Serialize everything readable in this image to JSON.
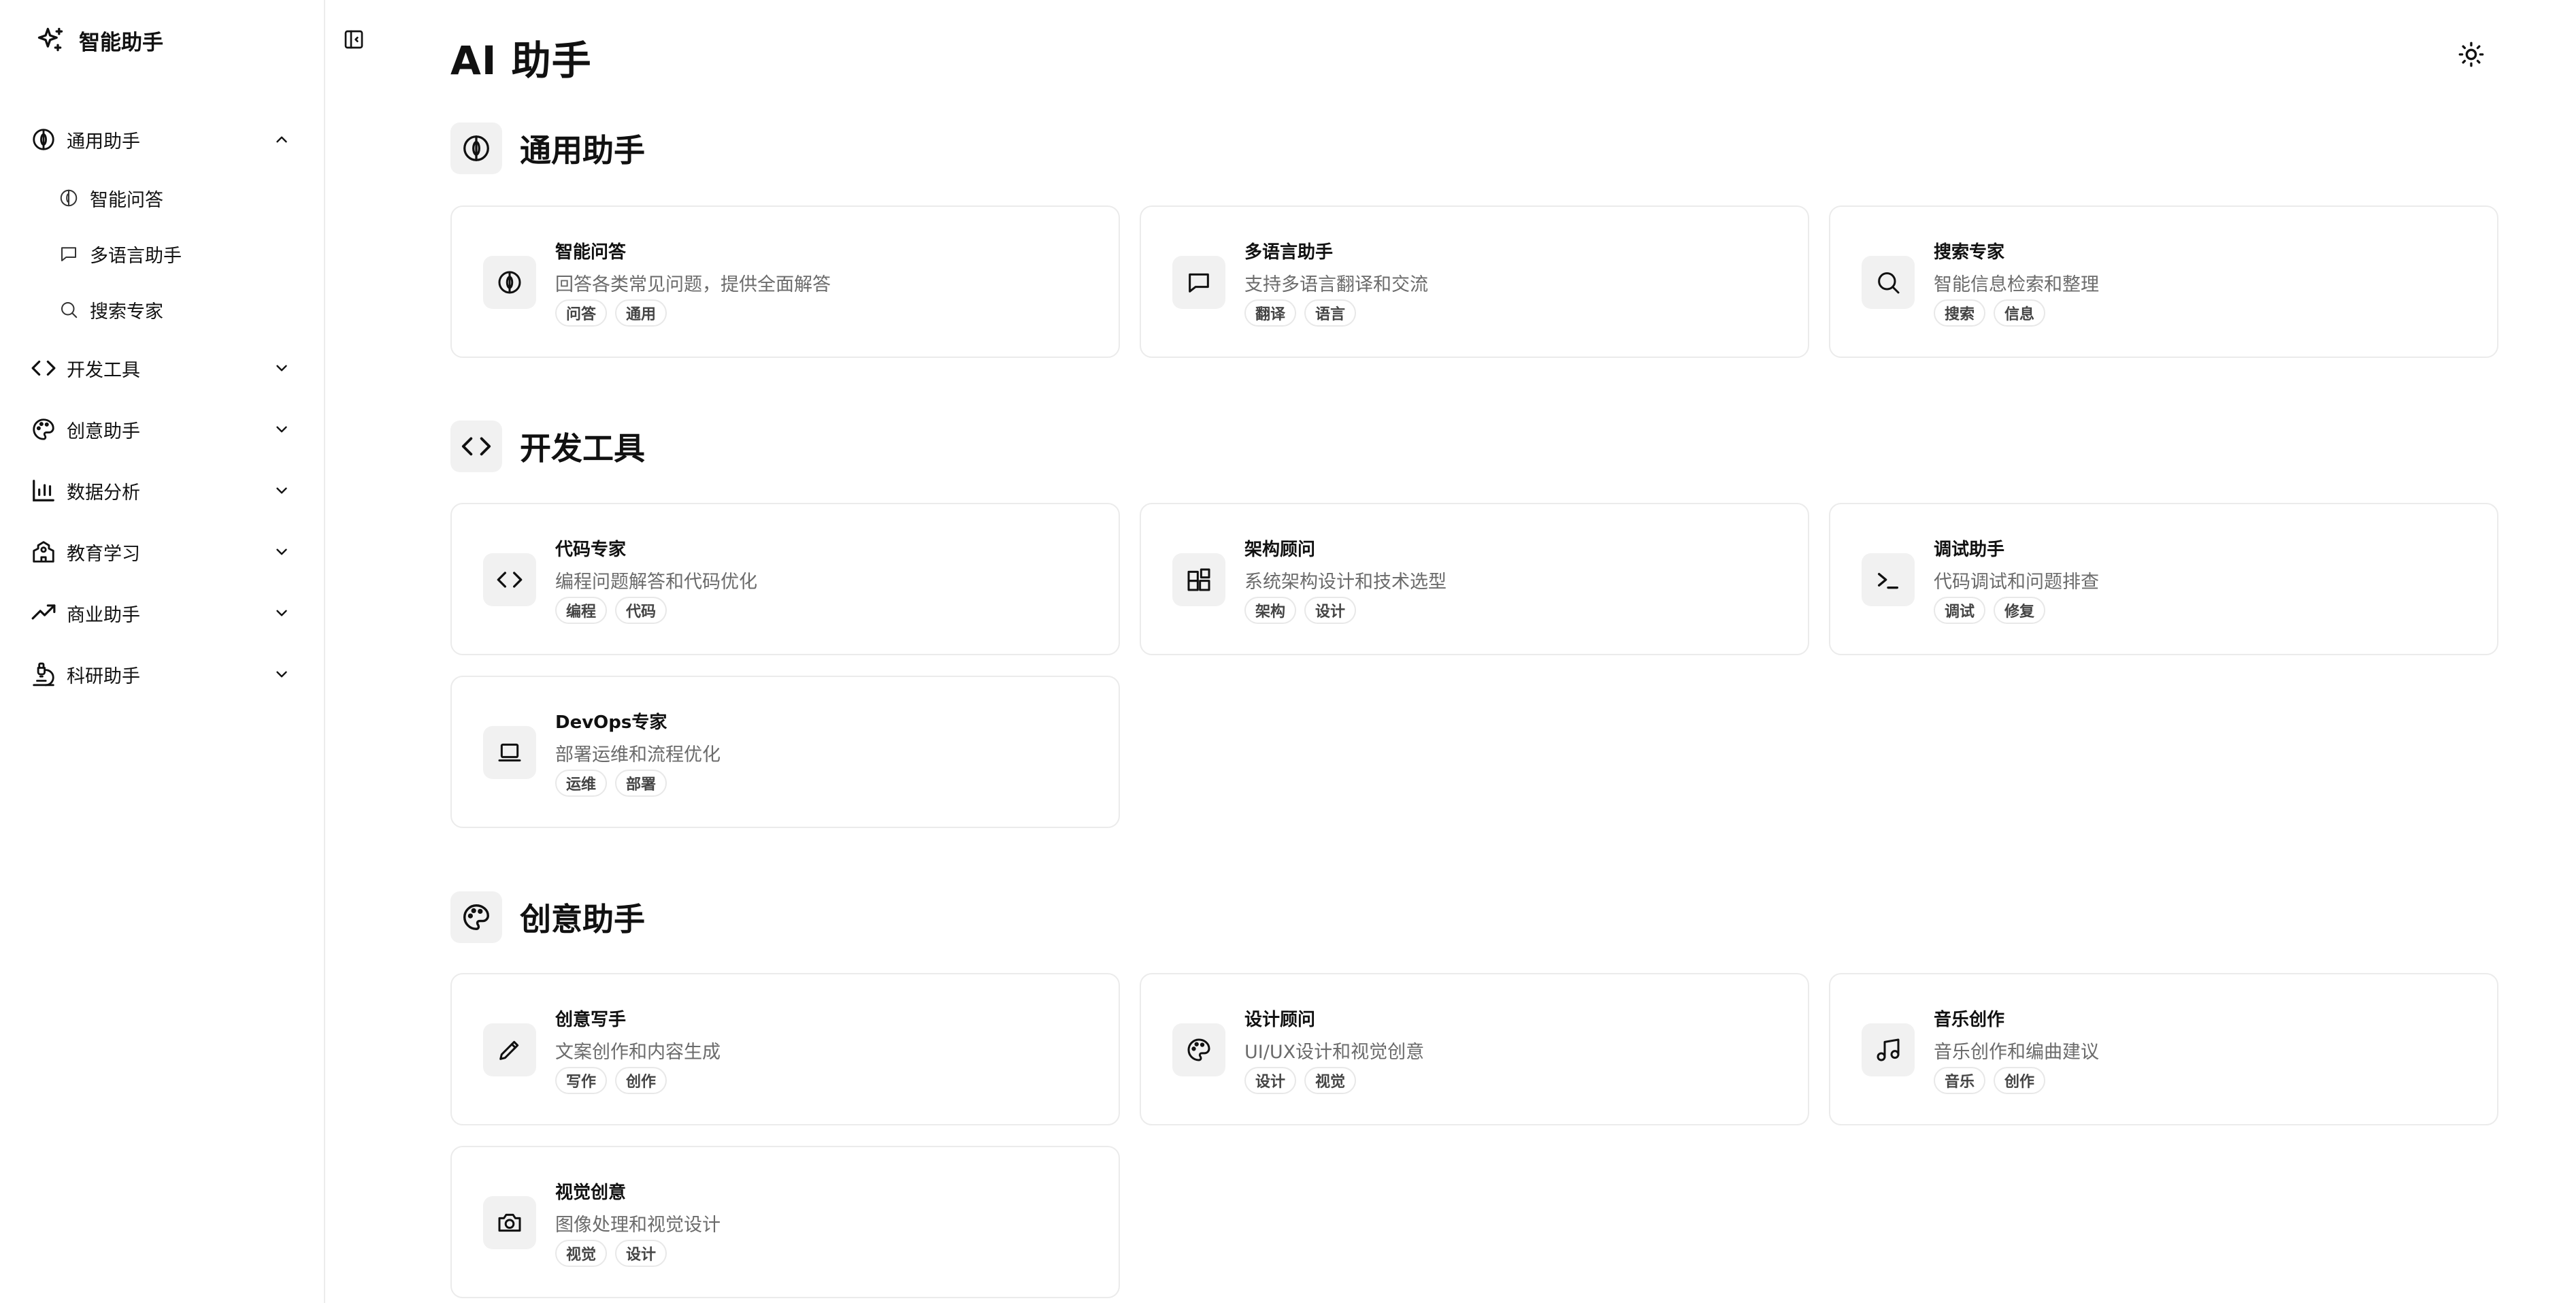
{
  "brand": {
    "name": "智能助手",
    "icon": "sparkles-icon"
  },
  "page": {
    "title": "AI 助手"
  },
  "sidebar": {
    "groups": [
      {
        "label": "通用助手",
        "icon": "brain-icon",
        "expanded": true,
        "items": [
          {
            "label": "智能问答",
            "icon": "brain-icon"
          },
          {
            "label": "多语言助手",
            "icon": "message-icon"
          },
          {
            "label": "搜索专家",
            "icon": "search-icon"
          }
        ]
      },
      {
        "label": "开发工具",
        "icon": "code-icon",
        "expanded": false
      },
      {
        "label": "创意助手",
        "icon": "palette-icon",
        "expanded": false
      },
      {
        "label": "数据分析",
        "icon": "bar-chart-icon",
        "expanded": false
      },
      {
        "label": "教育学习",
        "icon": "school-icon",
        "expanded": false
      },
      {
        "label": "商业助手",
        "icon": "trending-up-icon",
        "expanded": false
      },
      {
        "label": "科研助手",
        "icon": "microscope-icon",
        "expanded": false
      }
    ]
  },
  "sections": [
    {
      "title": "通用助手",
      "icon": "brain-icon",
      "cards": [
        {
          "title": "智能问答",
          "desc": "回答各类常见问题，提供全面解答",
          "tags": [
            "问答",
            "通用"
          ],
          "icon": "brain-icon"
        },
        {
          "title": "多语言助手",
          "desc": "支持多语言翻译和交流",
          "tags": [
            "翻译",
            "语言"
          ],
          "icon": "message-icon"
        },
        {
          "title": "搜索专家",
          "desc": "智能信息检索和整理",
          "tags": [
            "搜索",
            "信息"
          ],
          "icon": "search-icon"
        }
      ]
    },
    {
      "title": "开发工具",
      "icon": "code-icon",
      "cards": [
        {
          "title": "代码专家",
          "desc": "编程问题解答和代码优化",
          "tags": [
            "编程",
            "代码"
          ],
          "icon": "code-icon"
        },
        {
          "title": "架构顾问",
          "desc": "系统架构设计和技术选型",
          "tags": [
            "架构",
            "设计"
          ],
          "icon": "blocks-icon"
        },
        {
          "title": "调试助手",
          "desc": "代码调试和问题排查",
          "tags": [
            "调试",
            "修复"
          ],
          "icon": "terminal-icon"
        },
        {
          "title": "DevOps专家",
          "desc": "部署运维和流程优化",
          "tags": [
            "运维",
            "部署"
          ],
          "icon": "laptop-icon"
        }
      ]
    },
    {
      "title": "创意助手",
      "icon": "palette-icon",
      "cards": [
        {
          "title": "创意写手",
          "desc": "文案创作和内容生成",
          "tags": [
            "写作",
            "创作"
          ],
          "icon": "pencil-icon"
        },
        {
          "title": "设计顾问",
          "desc": "UI/UX设计和视觉创意",
          "tags": [
            "设计",
            "视觉"
          ],
          "icon": "palette-icon"
        },
        {
          "title": "音乐创作",
          "desc": "音乐创作和编曲建议",
          "tags": [
            "音乐",
            "创作"
          ],
          "icon": "music-icon"
        },
        {
          "title": "视觉创意",
          "desc": "图像处理和视觉设计",
          "tags": [
            "视觉",
            "设计"
          ],
          "icon": "camera-icon"
        }
      ]
    }
  ],
  "colors": {
    "border": "#ebebeb",
    "icon_bg": "#f1f1f1",
    "muted_text": "#6b6b6b",
    "text": "#111111"
  }
}
